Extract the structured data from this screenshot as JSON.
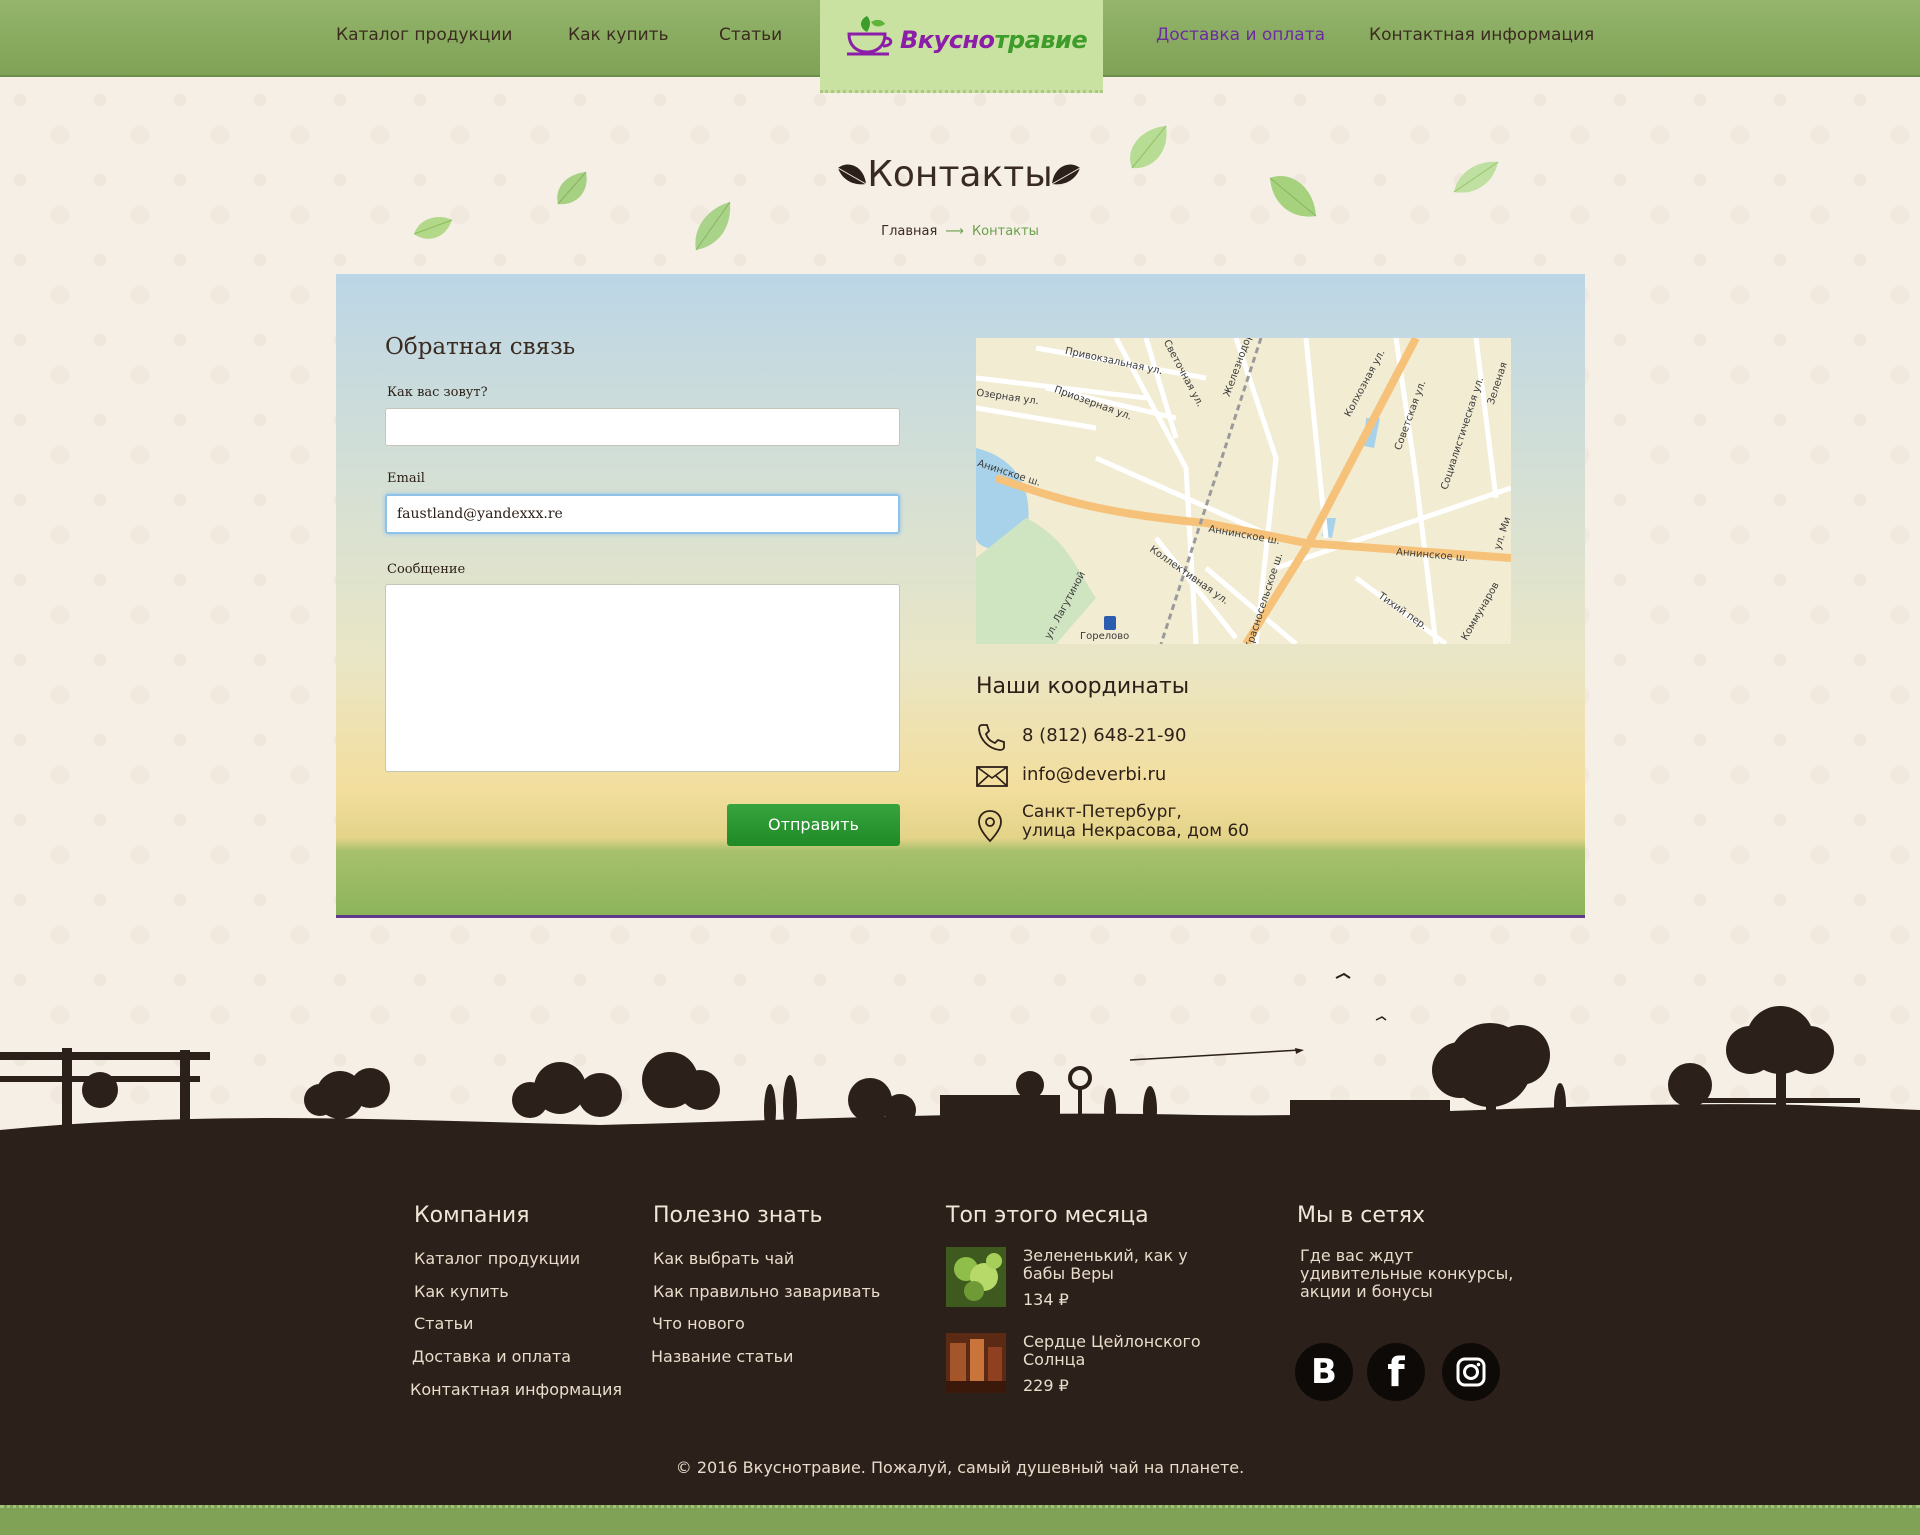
{
  "nav": {
    "items": [
      {
        "label": "Каталог продукции"
      },
      {
        "label": "Как купить"
      },
      {
        "label": "Статьи"
      },
      {
        "label": "Доставка и оплата"
      },
      {
        "label": "Контактная информация"
      }
    ],
    "logo_text_a": "Вкусно",
    "logo_text_b": "травие",
    "active_color": "#6a2ca0"
  },
  "page": {
    "title": "Контакты",
    "breadcrumb": {
      "home": "Главная",
      "arrow": "⟶",
      "current": "Контакты"
    }
  },
  "form": {
    "title": "Обратная связь",
    "name_label": "Как вас зовут?",
    "name_value": "",
    "email_label": "Email",
    "email_value": "faustland@yandexxx.re",
    "message_label": "Сообщение",
    "message_value": "",
    "submit_label": "Отправить"
  },
  "map": {
    "labels": [
      "Привокзальная ул.",
      "Светочная ул.",
      "Железнодор.",
      "Приозерная ул.",
      "Колхозная ул.",
      "Советская ул.",
      "Социалистическая ул.",
      "Зеленая",
      "Анинское ш.",
      "Аннинское ш.",
      "Аннинское ш.",
      "Коллективная ул.",
      "Красносельское ш.",
      "Тихий пер.",
      "Коммунаров",
      "Горелово",
      "ул. Лагутиной",
      "ул. Ми",
      "Озерная ул."
    ]
  },
  "coordinates": {
    "title": "Наши координаты",
    "phone": "8 (812) 648-21-90",
    "email": "info@deverbi.ru",
    "address_line1": "Санкт-Петербург,",
    "address_line2": "улица Некрасова, дом 60"
  },
  "footer": {
    "company": {
      "title": "Компания",
      "links": [
        "Каталог продукции",
        "Как купить",
        "Статьи",
        "Доставка и оплата",
        "Контактная информация"
      ]
    },
    "useful": {
      "title": "Полезно знать",
      "links": [
        "Как выбрать чай",
        "Как правильно заваривать",
        "Что нового",
        "Название статьи"
      ]
    },
    "top": {
      "title": "Топ этого месяца",
      "products": [
        {
          "name": "Зелененький, как у бабы Веры",
          "price": "134 ₽"
        },
        {
          "name": "Сердце Цейлонского Солнца",
          "price": "229 ₽"
        }
      ]
    },
    "social": {
      "title": "Мы в сетях",
      "text": "Где вас ждут удивительные конкурсы, акции и бонусы",
      "icons": [
        {
          "name": "vk-icon",
          "glyph": "B"
        },
        {
          "name": "facebook-icon",
          "glyph": "f"
        },
        {
          "name": "instagram-icon",
          "glyph": "◎"
        }
      ]
    },
    "copyright": "© 2016 Вкуснотравие. Пожалуй, самый душевный чай на планете."
  }
}
